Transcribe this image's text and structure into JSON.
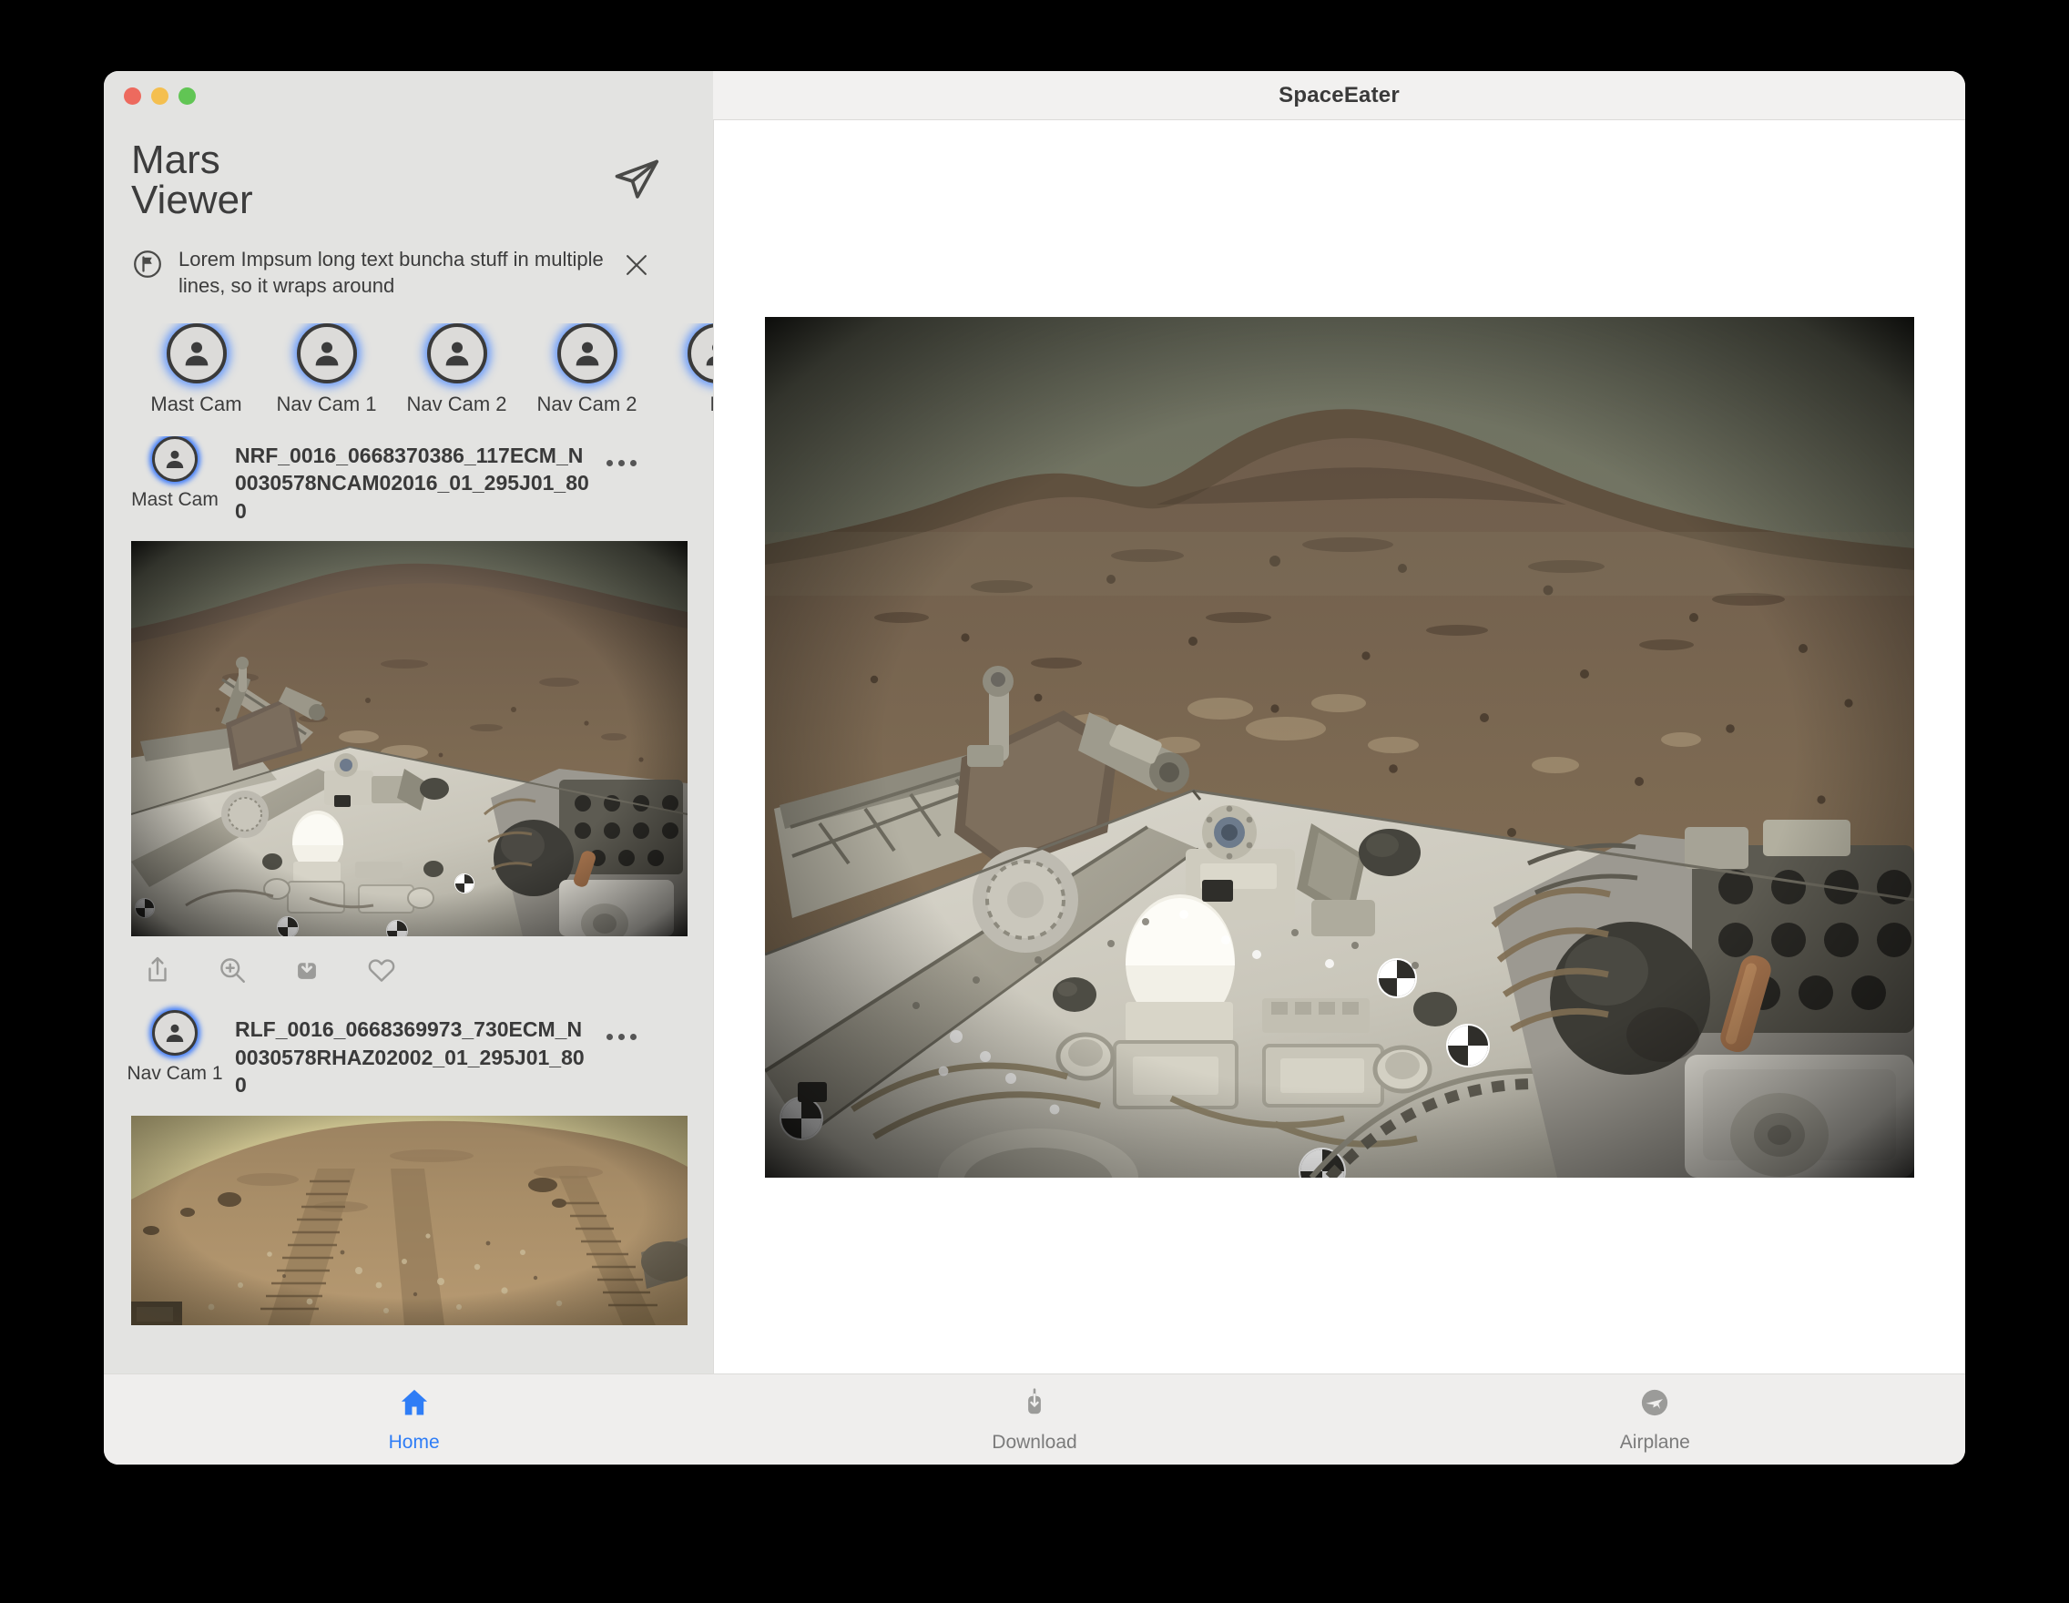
{
  "window": {
    "title": "SpaceEater",
    "traffic_lights": [
      "close",
      "minimize",
      "zoom"
    ]
  },
  "sidebar": {
    "app_title": "Mars\nViewer",
    "app_title_line1": "Mars",
    "app_title_line2": "Viewer",
    "send_icon": "send-icon",
    "banner": {
      "icon": "flag-circle-icon",
      "text": "Lorem Impsum long text buncha stuff in multiple lines, so it wraps around",
      "close_icon": "close-icon"
    },
    "camera_strip": [
      {
        "label": "Mast Cam",
        "icon": "person-avatar-icon",
        "selected": true
      },
      {
        "label": "Nav Cam 1",
        "icon": "person-avatar-icon",
        "selected": true
      },
      {
        "label": "Nav Cam 2",
        "icon": "person-avatar-icon",
        "selected": true
      },
      {
        "label": "Nav Cam 2",
        "icon": "person-avatar-icon",
        "selected": true
      },
      {
        "label": "N",
        "icon": "person-avatar-icon",
        "selected": true
      }
    ],
    "cards": [
      {
        "camera": "Mast Cam",
        "title": "NRF_0016_0668370386_117ECM_N0030578NCAM02016_01_295J01_800",
        "more_icon": "more-horizontal-icon",
        "image_alt": "Mars rover deck with mesa ridge on horizon",
        "actions": [
          {
            "name": "share-icon",
            "label": "Share"
          },
          {
            "name": "zoom-in-icon",
            "label": "Zoom"
          },
          {
            "name": "download-icon",
            "label": "Download"
          },
          {
            "name": "heart-icon",
            "label": "Favorite"
          }
        ]
      },
      {
        "camera": "Nav Cam 1",
        "title": "RLF_0016_0668369973_730ECM_N0030578RHAZ02002_01_295J01_800",
        "more_icon": "more-horizontal-icon",
        "image_alt": "Mars terrain with rover wheel tracks, rear hazcam fisheye view"
      }
    ]
  },
  "main": {
    "image_alt": "Mars Perseverance rover deck and Jezero crater ridge"
  },
  "tabbar": [
    {
      "label": "Home",
      "icon": "home-icon",
      "active": true
    },
    {
      "label": "Download",
      "icon": "download-icon",
      "active": false
    },
    {
      "label": "Airplane",
      "icon": "airplane-icon",
      "active": false
    }
  ],
  "colors": {
    "accent_blue": "#2f7df6",
    "sidebar_bg": "#e3e3e1",
    "main_bg": "#ffffff",
    "tabbar_bg": "#efeeed",
    "text": "#3c3c3c",
    "muted_text": "#7b7b7b"
  }
}
